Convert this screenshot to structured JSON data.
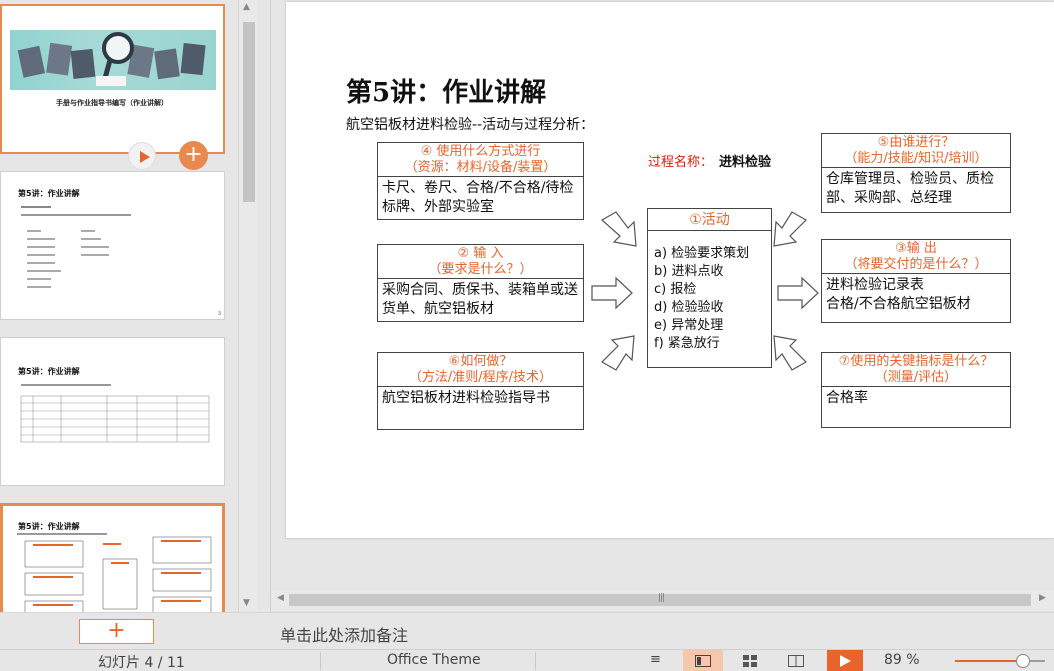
{
  "thumbnails": {
    "slide1_title": "手册与作业指导书编写（作业讲解）",
    "slide2": {
      "title": "第5讲：作业讲解",
      "num": "3"
    },
    "slide3": {
      "title": "第5讲：作业讲解"
    },
    "slide4": {
      "title": "第5讲：作业讲解"
    }
  },
  "slide": {
    "title_prefix": "第",
    "title_num": "5",
    "title_suffix": "讲：作业讲解",
    "subtitle": "航空铝板材进料检验--活动与过程分析：",
    "process_label": "过程名称：",
    "process_value": "进料检验",
    "box4": {
      "head1": "④ 使用什么方式进行",
      "head2": "（资源：材料/设备/装置）",
      "body": "卡尺、卷尺、合格/不合格/待检标牌、外部实验室"
    },
    "box2": {
      "head1": "②  输  入",
      "head2": "（要求是什么？）",
      "body": "采购合同、质保书、装箱单或送货单、航空铝板材"
    },
    "box6": {
      "head1": "⑥如何做？",
      "head2": "（方法/准则/程序/技术）",
      "body": "航空铝板材进料检验指导书"
    },
    "box1": {
      "head": "①活动",
      "items": [
        "a)  检验要求策划",
        "b)  进料点收",
        "c)  报检",
        "d)  检验验收",
        "e)  异常处理",
        "f)   紧急放行"
      ]
    },
    "box5": {
      "head1": "⑤由谁进行？",
      "head2": "（能力/技能/知识/培训）",
      "body": "仓库管理员、检验员、质检部、采购部、总经理"
    },
    "box3": {
      "head1": "③输  出",
      "head2": "（将要交付的是什么？）",
      "body1": "进料检验记录表",
      "body2": "合格/不合格航空铝板材"
    },
    "box7": {
      "head1": "⑦使用的关键指标是什么？",
      "head2": "（测量/评估）",
      "body": "合格率"
    }
  },
  "notes_placeholder": "单击此处添加备注",
  "status": {
    "slide_counter": "幻灯片 4 / 11",
    "theme": "Office Theme",
    "zoom": "89 %",
    "zoom_level_fraction": 0.72
  },
  "colors": {
    "accent": "#e8642c",
    "header_text": "#e8642c",
    "process_red": "#d81e06"
  }
}
